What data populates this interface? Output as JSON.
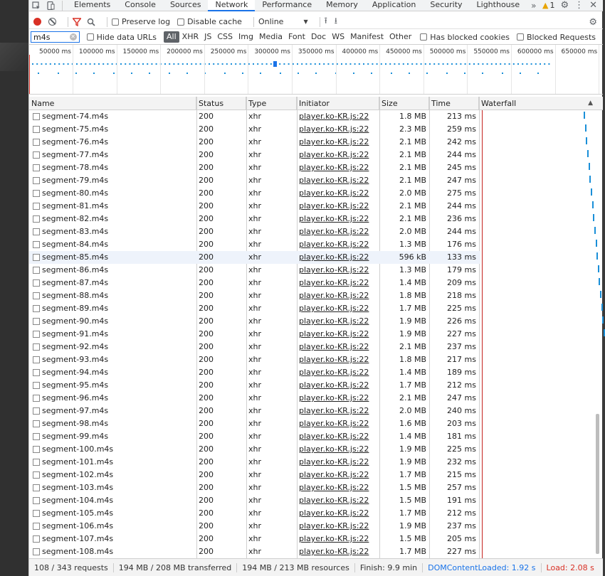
{
  "tabs": [
    "Elements",
    "Console",
    "Sources",
    "Network",
    "Performance",
    "Memory",
    "Application",
    "Security",
    "Lighthouse"
  ],
  "active_tab": "Network",
  "warning_count": "1",
  "toolbar": {
    "preserve_log": "Preserve log",
    "disable_cache": "Disable cache",
    "throttling": "Online"
  },
  "filter": {
    "value": "m4s",
    "hide_data_urls": "Hide data URLs",
    "types": [
      "All",
      "XHR",
      "JS",
      "CSS",
      "Img",
      "Media",
      "Font",
      "Doc",
      "WS",
      "Manifest",
      "Other"
    ],
    "has_blocked_cookies": "Has blocked cookies",
    "blocked_requests": "Blocked Requests"
  },
  "overview": {
    "ticks": [
      "50000 ms",
      "100000 ms",
      "150000 ms",
      "200000 ms",
      "250000 ms",
      "300000 ms",
      "350000 ms",
      "400000 ms",
      "450000 ms",
      "500000 ms",
      "550000 ms",
      "600000 ms",
      "650000 ms"
    ]
  },
  "columns": {
    "name": "Name",
    "status": "Status",
    "type": "Type",
    "initiator": "Initiator",
    "size": "Size",
    "time": "Time",
    "waterfall": "Waterfall"
  },
  "rows": [
    {
      "name": "segment-74.m4s",
      "status": "200",
      "type": "xhr",
      "initiator": "player.ko-KR.js:22",
      "size": "1.8 MB",
      "time": "213 ms"
    },
    {
      "name": "segment-75.m4s",
      "status": "200",
      "type": "xhr",
      "initiator": "player.ko-KR.js:22",
      "size": "2.3 MB",
      "time": "259 ms"
    },
    {
      "name": "segment-76.m4s",
      "status": "200",
      "type": "xhr",
      "initiator": "player.ko-KR.js:22",
      "size": "2.1 MB",
      "time": "242 ms"
    },
    {
      "name": "segment-77.m4s",
      "status": "200",
      "type": "xhr",
      "initiator": "player.ko-KR.js:22",
      "size": "2.1 MB",
      "time": "244 ms"
    },
    {
      "name": "segment-78.m4s",
      "status": "200",
      "type": "xhr",
      "initiator": "player.ko-KR.js:22",
      "size": "2.1 MB",
      "time": "245 ms"
    },
    {
      "name": "segment-79.m4s",
      "status": "200",
      "type": "xhr",
      "initiator": "player.ko-KR.js:22",
      "size": "2.1 MB",
      "time": "247 ms"
    },
    {
      "name": "segment-80.m4s",
      "status": "200",
      "type": "xhr",
      "initiator": "player.ko-KR.js:22",
      "size": "2.0 MB",
      "time": "275 ms"
    },
    {
      "name": "segment-81.m4s",
      "status": "200",
      "type": "xhr",
      "initiator": "player.ko-KR.js:22",
      "size": "2.1 MB",
      "time": "244 ms"
    },
    {
      "name": "segment-82.m4s",
      "status": "200",
      "type": "xhr",
      "initiator": "player.ko-KR.js:22",
      "size": "2.1 MB",
      "time": "236 ms"
    },
    {
      "name": "segment-83.m4s",
      "status": "200",
      "type": "xhr",
      "initiator": "player.ko-KR.js:22",
      "size": "2.0 MB",
      "time": "244 ms"
    },
    {
      "name": "segment-84.m4s",
      "status": "200",
      "type": "xhr",
      "initiator": "player.ko-KR.js:22",
      "size": "1.3 MB",
      "time": "176 ms"
    },
    {
      "name": "segment-85.m4s",
      "status": "200",
      "type": "xhr",
      "initiator": "player.ko-KR.js:22",
      "size": "596 kB",
      "time": "133 ms"
    },
    {
      "name": "segment-86.m4s",
      "status": "200",
      "type": "xhr",
      "initiator": "player.ko-KR.js:22",
      "size": "1.3 MB",
      "time": "179 ms"
    },
    {
      "name": "segment-87.m4s",
      "status": "200",
      "type": "xhr",
      "initiator": "player.ko-KR.js:22",
      "size": "1.4 MB",
      "time": "209 ms"
    },
    {
      "name": "segment-88.m4s",
      "status": "200",
      "type": "xhr",
      "initiator": "player.ko-KR.js:22",
      "size": "1.8 MB",
      "time": "218 ms"
    },
    {
      "name": "segment-89.m4s",
      "status": "200",
      "type": "xhr",
      "initiator": "player.ko-KR.js:22",
      "size": "1.7 MB",
      "time": "225 ms"
    },
    {
      "name": "segment-90.m4s",
      "status": "200",
      "type": "xhr",
      "initiator": "player.ko-KR.js:22",
      "size": "1.9 MB",
      "time": "226 ms"
    },
    {
      "name": "segment-91.m4s",
      "status": "200",
      "type": "xhr",
      "initiator": "player.ko-KR.js:22",
      "size": "1.9 MB",
      "time": "227 ms"
    },
    {
      "name": "segment-92.m4s",
      "status": "200",
      "type": "xhr",
      "initiator": "player.ko-KR.js:22",
      "size": "2.1 MB",
      "time": "237 ms"
    },
    {
      "name": "segment-93.m4s",
      "status": "200",
      "type": "xhr",
      "initiator": "player.ko-KR.js:22",
      "size": "1.8 MB",
      "time": "217 ms"
    },
    {
      "name": "segment-94.m4s",
      "status": "200",
      "type": "xhr",
      "initiator": "player.ko-KR.js:22",
      "size": "1.4 MB",
      "time": "189 ms"
    },
    {
      "name": "segment-95.m4s",
      "status": "200",
      "type": "xhr",
      "initiator": "player.ko-KR.js:22",
      "size": "1.7 MB",
      "time": "212 ms"
    },
    {
      "name": "segment-96.m4s",
      "status": "200",
      "type": "xhr",
      "initiator": "player.ko-KR.js:22",
      "size": "2.1 MB",
      "time": "247 ms"
    },
    {
      "name": "segment-97.m4s",
      "status": "200",
      "type": "xhr",
      "initiator": "player.ko-KR.js:22",
      "size": "2.0 MB",
      "time": "240 ms"
    },
    {
      "name": "segment-98.m4s",
      "status": "200",
      "type": "xhr",
      "initiator": "player.ko-KR.js:22",
      "size": "1.6 MB",
      "time": "203 ms"
    },
    {
      "name": "segment-99.m4s",
      "status": "200",
      "type": "xhr",
      "initiator": "player.ko-KR.js:22",
      "size": "1.4 MB",
      "time": "181 ms"
    },
    {
      "name": "segment-100.m4s",
      "status": "200",
      "type": "xhr",
      "initiator": "player.ko-KR.js:22",
      "size": "1.9 MB",
      "time": "225 ms"
    },
    {
      "name": "segment-101.m4s",
      "status": "200",
      "type": "xhr",
      "initiator": "player.ko-KR.js:22",
      "size": "1.9 MB",
      "time": "232 ms"
    },
    {
      "name": "segment-102.m4s",
      "status": "200",
      "type": "xhr",
      "initiator": "player.ko-KR.js:22",
      "size": "1.7 MB",
      "time": "215 ms"
    },
    {
      "name": "segment-103.m4s",
      "status": "200",
      "type": "xhr",
      "initiator": "player.ko-KR.js:22",
      "size": "1.5 MB",
      "time": "257 ms"
    },
    {
      "name": "segment-104.m4s",
      "status": "200",
      "type": "xhr",
      "initiator": "player.ko-KR.js:22",
      "size": "1.5 MB",
      "time": "191 ms"
    },
    {
      "name": "segment-105.m4s",
      "status": "200",
      "type": "xhr",
      "initiator": "player.ko-KR.js:22",
      "size": "1.7 MB",
      "time": "212 ms"
    },
    {
      "name": "segment-106.m4s",
      "status": "200",
      "type": "xhr",
      "initiator": "player.ko-KR.js:22",
      "size": "1.9 MB",
      "time": "237 ms"
    },
    {
      "name": "segment-107.m4s",
      "status": "200",
      "type": "xhr",
      "initiator": "player.ko-KR.js:22",
      "size": "1.5 MB",
      "time": "205 ms"
    },
    {
      "name": "segment-108.m4s",
      "status": "200",
      "type": "xhr",
      "initiator": "player.ko-KR.js:22",
      "size": "1.7 MB",
      "time": "227 ms"
    }
  ],
  "highlighted_row": "segment-85.m4s",
  "status_bar": {
    "requests": "108 / 343 requests",
    "transferred": "194 MB / 208 MB transferred",
    "resources": "194 MB / 213 MB resources",
    "finish": "Finish: 9.9 min",
    "dom_content_loaded": "DOMContentLoaded: 1.92 s",
    "load": "Load: 2.08 s"
  },
  "colors": {
    "accent": "#1a73e8",
    "record": "#d93025",
    "waterfall_bar": "#1a8fd8",
    "load_line": "#c5221f"
  }
}
